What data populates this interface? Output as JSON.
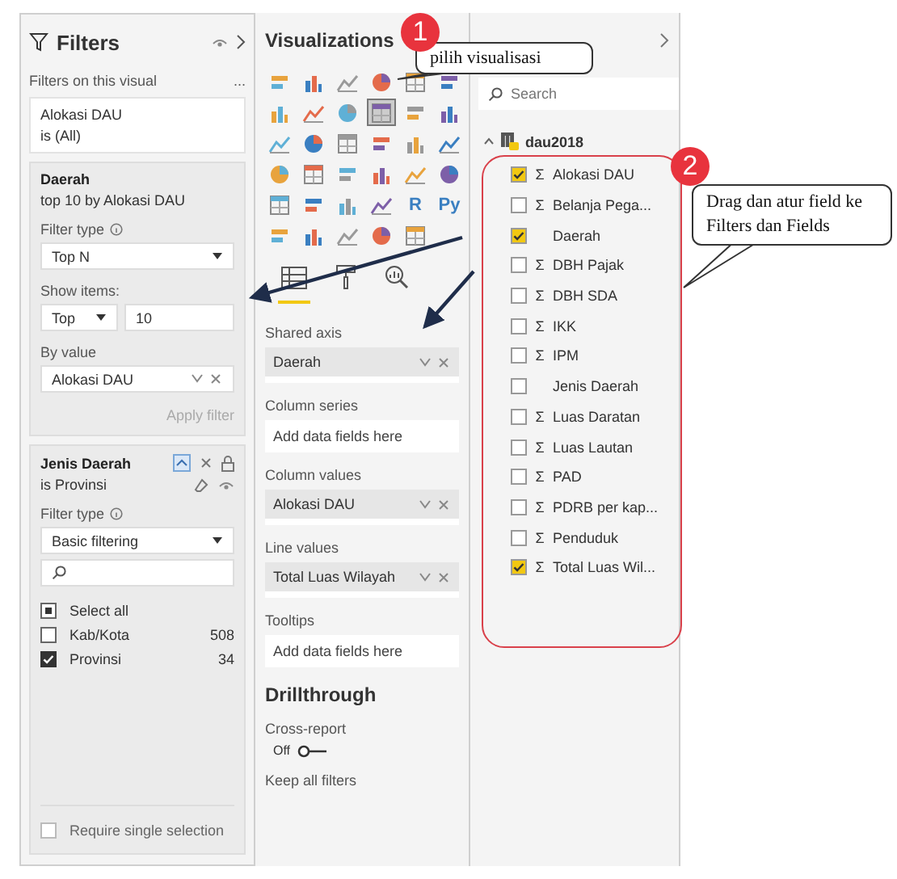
{
  "filters": {
    "title": "Filters",
    "section_label": "Filters on this visual",
    "more": "...",
    "summary_card": {
      "field": "Alokasi DAU",
      "condition": "is (All)"
    },
    "topn_card": {
      "field": "Daerah",
      "condition": "top 10 by Alokasi DAU",
      "filter_type_label": "Filter type",
      "filter_type": "Top N",
      "show_items_label": "Show items:",
      "direction": "Top",
      "count": "10",
      "by_value_label": "By value",
      "by_value": "Alokasi DAU",
      "apply": "Apply filter",
      "apply_disabled": true
    },
    "basic_card": {
      "field": "Jenis Daerah",
      "condition": "is Provinsi",
      "filter_type_label": "Filter type",
      "filter_type": "Basic filtering",
      "select_all": {
        "label": "Select all",
        "partial": true
      },
      "options": [
        {
          "label": "Kab/Kota",
          "count": "508",
          "checked": false
        },
        {
          "label": "Provinsi",
          "count": "34",
          "checked": true
        }
      ],
      "require_single": {
        "label": "Require single selection",
        "checked": false
      }
    }
  },
  "visualizations": {
    "title": "Visualizations",
    "gallery": [
      {
        "selected": false
      },
      {
        "selected": false
      },
      {
        "selected": false
      },
      {
        "selected": false
      },
      {
        "selected": false
      },
      {
        "selected": false
      },
      {
        "selected": false
      },
      {
        "selected": false
      },
      {
        "selected": false
      },
      {
        "selected": true
      },
      {
        "selected": false
      },
      {
        "selected": false
      },
      {
        "selected": false
      },
      {
        "selected": false
      },
      {
        "selected": false
      },
      {
        "selected": false
      },
      {
        "selected": false
      },
      {
        "selected": false
      },
      {
        "selected": false
      },
      {
        "selected": false
      },
      {
        "selected": false
      },
      {
        "selected": false
      },
      {
        "selected": false
      },
      {
        "selected": false
      },
      {
        "selected": false
      },
      {
        "selected": false
      },
      {
        "selected": false
      },
      {
        "selected": false
      },
      {
        "label": "R",
        "selected": false
      },
      {
        "label": "Py",
        "selected": false
      },
      {
        "selected": false
      },
      {
        "selected": false
      },
      {
        "selected": false
      },
      {
        "selected": false
      },
      {
        "selected": false
      }
    ],
    "pane_tabs": [
      {
        "selected": true
      },
      {
        "selected": false
      },
      {
        "selected": false
      }
    ],
    "wells": [
      {
        "label": "Shared axis",
        "field": "Daerah"
      },
      {
        "label": "Column series",
        "placeholder": "Add data fields here"
      },
      {
        "label": "Column values",
        "field": "Alokasi DAU"
      },
      {
        "label": "Line values",
        "field": "Total Luas Wilayah"
      },
      {
        "label": "Tooltips",
        "placeholder": "Add data fields here"
      }
    ],
    "drillthrough": {
      "title": "Drillthrough",
      "cross_report_label": "Cross-report",
      "cross_report_state": "Off",
      "cross_report_on": false,
      "keep_filters_label": "Keep all filters"
    }
  },
  "fields": {
    "search": {
      "placeholder": "Search"
    },
    "table": {
      "name": "dau2018",
      "expanded": true,
      "columns": [
        {
          "label": "Alokasi DAU",
          "icon": "Σ",
          "checked": true
        },
        {
          "label": "Belanja Pega...",
          "icon": "Σ",
          "checked": false
        },
        {
          "label": "Daerah",
          "checked": true
        },
        {
          "label": "DBH Pajak",
          "icon": "Σ",
          "checked": false
        },
        {
          "label": "DBH SDA",
          "icon": "Σ",
          "checked": false
        },
        {
          "label": "IKK",
          "icon": "Σ",
          "checked": false
        },
        {
          "label": "IPM",
          "icon": "Σ",
          "checked": false
        },
        {
          "label": "Jenis Daerah",
          "checked": false
        },
        {
          "label": "Luas Daratan",
          "icon": "Σ",
          "checked": false
        },
        {
          "label": "Luas Lautan",
          "icon": "Σ",
          "checked": false
        },
        {
          "label": "PAD",
          "icon": "Σ",
          "checked": false
        },
        {
          "label": "PDRB per kap...",
          "icon": "Σ",
          "checked": false
        },
        {
          "label": "Penduduk",
          "icon": "Σ",
          "checked": false
        },
        {
          "label": "Total Luas Wil...",
          "icon": "Σ",
          "checked": true
        }
      ]
    }
  },
  "annotations": [
    {
      "number": "1",
      "text": "pilih visualisasi"
    },
    {
      "number": "2",
      "text": "Drag dan atur field ke Filters dan Fields"
    }
  ]
}
